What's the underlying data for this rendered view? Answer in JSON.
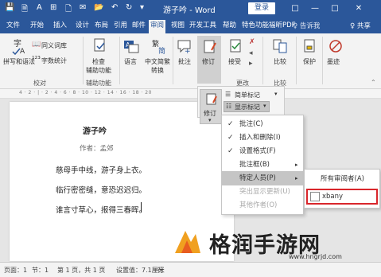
{
  "titlebar": {
    "document_title": "游子吟 - Word",
    "login_label": "登录",
    "restore_label": "□",
    "minimize_label": "—",
    "close_label": "✕",
    "maximize_label": "□"
  },
  "tabs": [
    "文件",
    "开始",
    "插入",
    "设计",
    "布局",
    "引用",
    "邮件",
    "审阅",
    "视图",
    "开发工具",
    "帮助",
    "特色功能",
    "福昕PDF"
  ],
  "active_tab": "审阅",
  "tell_me": "♀ 告诉我",
  "share": "♀ 共享",
  "ribbon": {
    "spelling": "拼写和语法",
    "thesaurus": "同义词库",
    "wordcount": "字数统计",
    "group_proofing": "校对",
    "accessibility": "检查\n辅助功能",
    "group_accessibility": "辅助功能",
    "language": "语言",
    "chinese_conv": "中文简繁\n转换",
    "comment": "批注",
    "track": "修订",
    "accept": "接受",
    "group_changes": "更改",
    "compare": "比较",
    "group_compare": "比较",
    "protect": "保护",
    "ink": "墨迹"
  },
  "tracking": {
    "simple_markup": "简单标记",
    "show_markup": "显示标记",
    "track_label": "修订"
  },
  "show_markup_menu": [
    {
      "label": "批注(C)",
      "checked": true
    },
    {
      "label": "插入和删除(I)",
      "checked": true
    },
    {
      "label": "设置格式(F)",
      "checked": true
    },
    {
      "label": "批注框(B)",
      "checked": false
    },
    {
      "label": "特定人员(P)",
      "checked": false
    },
    {
      "label": "突出显示更新(U)",
      "checked": false
    },
    {
      "label": "其他作者(O)",
      "checked": false
    }
  ],
  "people_menu": [
    "所有审阅者(A)",
    "xbany"
  ],
  "document": {
    "title": "游子吟",
    "author": "作者：孟郊",
    "line1": "慈母手中线，游子身上衣。",
    "line2": "临行密密缝，意恐迟迟归。",
    "line3": "谁言寸草心，报得三春晖。"
  },
  "ruler_text": "4 · 2 · | · 2 · 4 · 6 · 8 · 10 · 12 · 14 · 16 · 18 · 20",
  "statusbar": {
    "page": "页面：1",
    "section": "节：1",
    "pages": "第 1 页，共 1 页",
    "position": "设置值：7.1厘米",
    "row": "行"
  },
  "watermark": {
    "text": "格润手游网",
    "url": "www.hngrjd.com"
  },
  "colors": {
    "word_blue": "#2b579a",
    "highlight_red": "#d9262b"
  }
}
